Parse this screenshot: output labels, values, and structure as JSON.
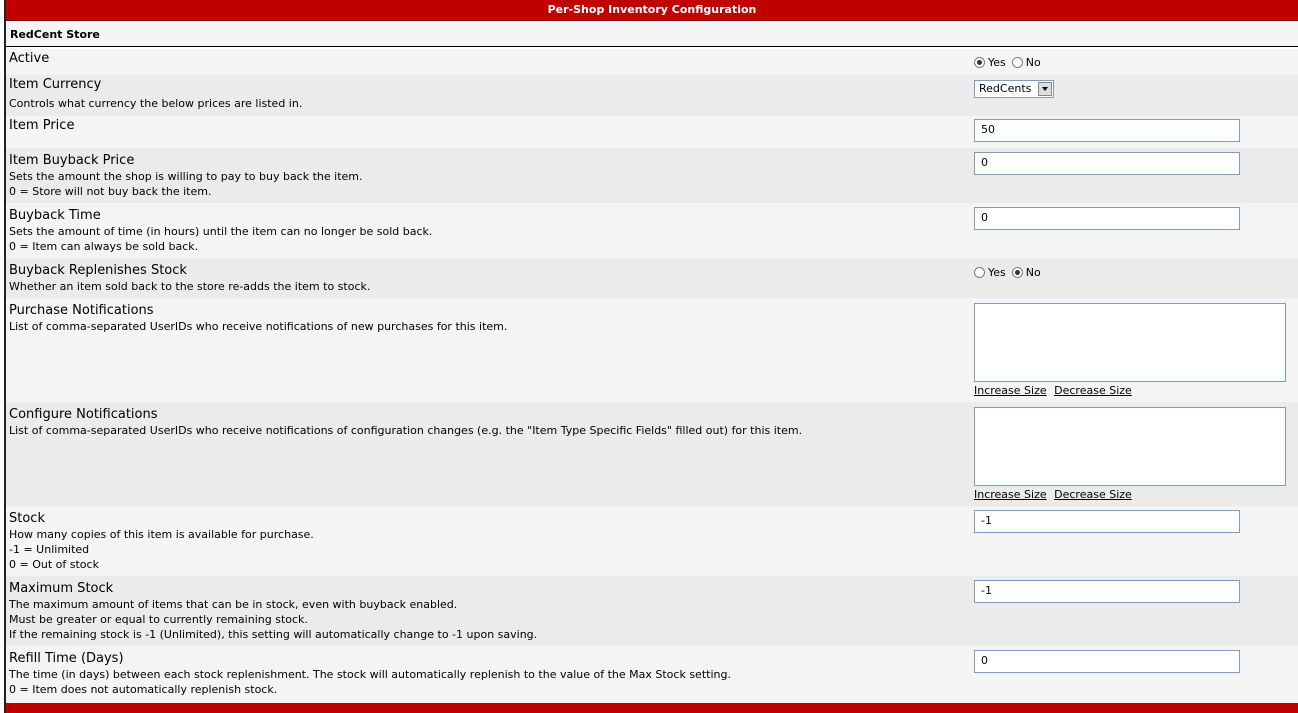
{
  "header": {
    "title": "Per-Shop Inventory Configuration"
  },
  "store": {
    "name": "RedCent Store"
  },
  "active": {
    "label": "Active",
    "yes": "Yes",
    "no": "No",
    "selected": "yes"
  },
  "currency": {
    "label": "Item Currency",
    "desc": "Controls what currency the below prices are listed in.",
    "value": "RedCents"
  },
  "price": {
    "label": "Item Price",
    "value": "50"
  },
  "buyback_price": {
    "label": "Item Buyback Price",
    "desc1": "Sets the amount the shop is willing to pay to buy back the item.",
    "desc2": "0 = Store will not buy back the item.",
    "value": "0"
  },
  "buyback_time": {
    "label": "Buyback Time",
    "desc1": "Sets the amount of time (in hours) until the item can no longer be sold back.",
    "desc2": "0 = Item can always be sold back.",
    "value": "0"
  },
  "buyback_replenish": {
    "label": "Buyback Replenishes Stock",
    "desc": "Whether an item sold back to the store re-adds the item to stock.",
    "yes": "Yes",
    "no": "No",
    "selected": "no"
  },
  "purchase_notif": {
    "label": "Purchase Notifications",
    "desc": "List of comma-separated UserIDs who receive notifications of new purchases for this item.",
    "increase": "Increase Size",
    "decrease": "Decrease Size"
  },
  "config_notif": {
    "label": "Configure Notifications",
    "desc": "List of comma-separated UserIDs who receive notifications of configuration changes (e.g. the \"Item Type Specific Fields\" filled out) for this item.",
    "increase": "Increase Size",
    "decrease": "Decrease Size"
  },
  "stock": {
    "label": "Stock",
    "desc1": "How many copies of this item is available for purchase.",
    "desc2": "-1 = Unlimited",
    "desc3": "0 = Out of stock",
    "value": "-1"
  },
  "max_stock": {
    "label": "Maximum Stock",
    "desc1": "The maximum amount of items that can be in stock, even with buyback enabled.",
    "desc2": "Must be greater or equal to currently remaining stock.",
    "desc3": "If the remaining stock is -1 (Unlimited), this setting will automatically change to -1 upon saving.",
    "value": "-1"
  },
  "refill": {
    "label": "Refill Time (Days)",
    "desc1": "The time (in days) between each stock replenishment. The stock will automatically replenish to the value of the Max Stock setting.",
    "desc2": "0 = Item does not automatically replenish stock.",
    "value": "0"
  }
}
